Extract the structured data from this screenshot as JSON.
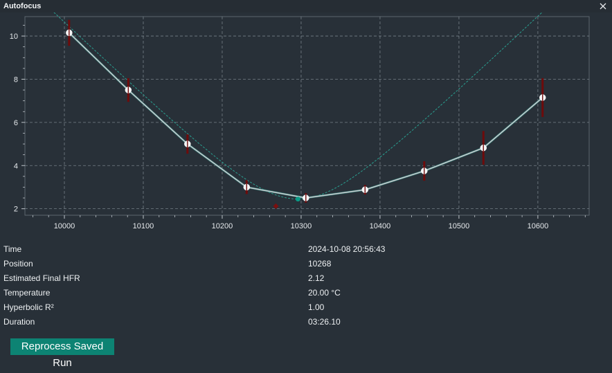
{
  "window": {
    "title": "Autofocus"
  },
  "chart_data": {
    "type": "scatter",
    "xlim": [
      9950,
      10665
    ],
    "ylim": [
      1.7,
      10.9
    ],
    "xticks": [
      10000,
      10100,
      10200,
      10300,
      10400,
      10500,
      10600
    ],
    "yticks": [
      2,
      4,
      6,
      8,
      10
    ],
    "grid": true,
    "colors": {
      "measured": "#c8ccd0",
      "error_bar": "#6e0b0b",
      "trend": "#2f8f83",
      "hyperbolic": "#2aa091",
      "final_point": "#0a9a86",
      "grid": "#8a949c",
      "axis": "#c0c6cc"
    },
    "series": [
      {
        "role": "measured",
        "x": [
          10006,
          10081,
          10156,
          10231,
          10306,
          10381,
          10456,
          10531,
          10606
        ],
        "y": [
          10.15,
          7.5,
          5.0,
          3.0,
          2.5,
          2.88,
          3.75,
          4.82,
          7.15
        ],
        "error": [
          0.6,
          0.55,
          0.45,
          0.32,
          0.22,
          0.22,
          0.45,
          0.78,
          0.9
        ]
      }
    ],
    "final_focus": {
      "x": 10296,
      "y": 2.45
    },
    "trend_marker": {
      "x": 10268,
      "y": 2.12
    },
    "hyperbola": {
      "a": 2.45,
      "b": 70,
      "x0": 10296
    }
  },
  "info": {
    "rows": [
      {
        "label": "Time",
        "value": "2024-10-08 20:56:43"
      },
      {
        "label": "Position",
        "value": "10268"
      },
      {
        "label": "Estimated Final HFR",
        "value": "2.12"
      },
      {
        "label": "Temperature",
        "value": "20.00 °C"
      },
      {
        "label": "Hyperbolic R²",
        "value": "1.00"
      },
      {
        "label": "Duration",
        "value": "03:26.10"
      }
    ]
  },
  "actions": {
    "reprocess_label": "Reprocess Saved Run"
  }
}
